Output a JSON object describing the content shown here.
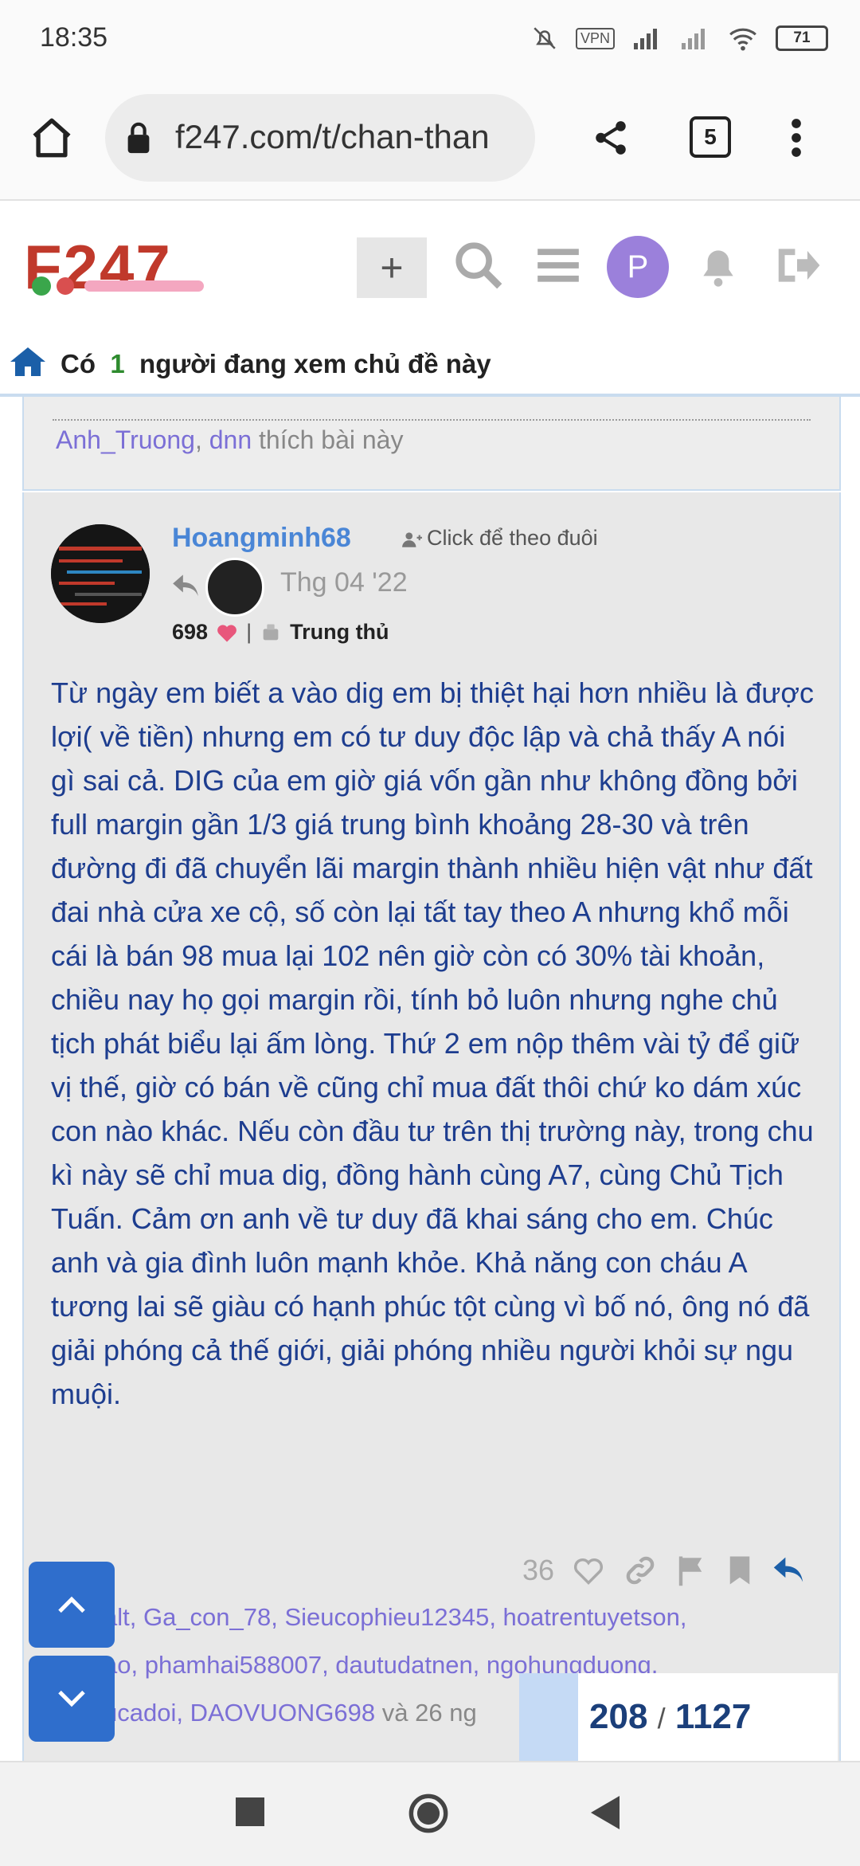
{
  "status": {
    "time": "18:35",
    "vpn": "VPN",
    "battery": "71"
  },
  "browser": {
    "url": "f247.com/t/chan-than",
    "tab_count": "5"
  },
  "forum": {
    "logo": "F247",
    "viewers_prefix": "Có",
    "viewers_count": "1",
    "viewers_suffix": "người đang xem chủ đề này"
  },
  "previous_post": {
    "likers": [
      "Anh_Truong",
      "dnn"
    ],
    "likers_suffix": "thích bài này"
  },
  "post": {
    "author": "Hoangminh68",
    "follow_label": "Click để theo đuôi",
    "date": "Thg 04 '22",
    "hearts": "698",
    "badge": "Trung thủ",
    "body": "Từ ngày em biết a vào dig em bị thiệt hại hơn nhiều là được lợi( về tiền) nhưng em có tư duy độc lập và chả thấy A nói gì sai cả. DIG của em giờ giá vốn gần như không đồng bởi full margin gần 1/3 giá trung bình khoảng 28-30 và trên đường đi đã chuyển lãi margin thành nhiều hiện vật như đất đai nhà cửa xe cộ, số còn lại tất tay theo A nhưng khổ mỗi cái là bán 98 mua lại 102 nên giờ còn có 30% tài khoản, chiều nay họ gọi margin rồi, tính bỏ luôn nhưng nghe chủ tịch phát biểu lại ấm lòng. Thứ 2 em nộp thêm vài tỷ để giữ vị thế, giờ có bán về cũng chỉ mua đất thôi chứ ko dám xúc con nào khác. Nếu còn đầu tư trên thị trường này, trong chu kì này sẽ chỉ mua dig, đồng hành cùng A7, cùng Chủ Tịch Tuấn. Cảm ơn anh về tư duy đã khai sáng cho em. Chúc anh và gia đình luôn mạnh khỏe. Khả năng con cháu A tương lai sẽ giàu có hạnh phúc tột cùng vì bố nó, ông nó đã giải phóng cả thế giới, giải phóng nhiều người khỏi sự ngu muội.",
    "like_count": "36",
    "likers_line1": "alt, Ga_con_78, Sieucophieu12345, hoatrentuyetson,",
    "likers_line2": "ao, phamhai588007, dautudatnen, ngohungduong,",
    "likers_line3": "ucadoi, DAOVUONG698",
    "likers_more": "và 26 ng"
  },
  "pagination": {
    "current": "208",
    "separator": "/",
    "total": "1127"
  }
}
